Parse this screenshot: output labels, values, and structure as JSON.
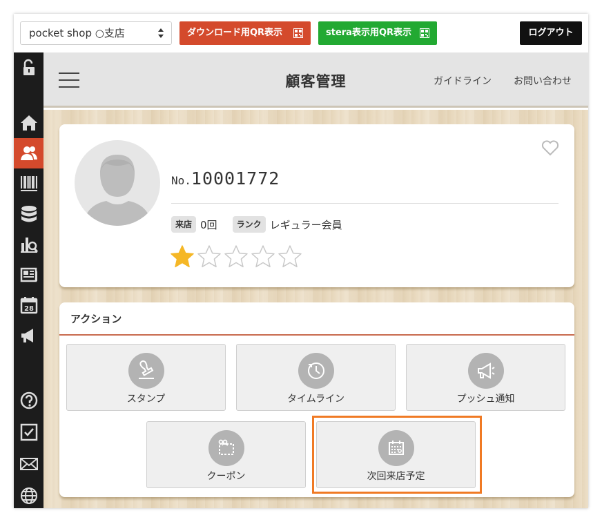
{
  "topbar": {
    "shop_select": "pocket shop ○支店",
    "download_qr": "ダウンロード用QR表示",
    "stera_qr": "stera表示用QR表示",
    "logout": "ログアウト"
  },
  "sidebar": {
    "items": [
      {
        "icon": "lock-icon"
      },
      {
        "icon": "home-icon"
      },
      {
        "icon": "users-icon",
        "active": true
      },
      {
        "icon": "barcode-icon"
      },
      {
        "icon": "database-icon"
      },
      {
        "icon": "analytics-icon"
      },
      {
        "icon": "news-icon"
      },
      {
        "icon": "calendar-icon",
        "text": "28"
      },
      {
        "icon": "megaphone-icon"
      },
      {
        "icon": "help-icon"
      },
      {
        "icon": "checkbox-icon"
      },
      {
        "icon": "mail-icon"
      },
      {
        "icon": "globe-icon"
      }
    ],
    "active_color": "#d44a2c"
  },
  "header": {
    "title": "顧客管理",
    "guideline": "ガイドライン",
    "contact": "お問い合わせ"
  },
  "profile": {
    "no_prefix": "No.",
    "member_number": "10001772",
    "visit_tag": "来店",
    "visit_value": "0回",
    "rank_tag": "ランク",
    "rank_value": "レギュラー会員",
    "rating": 1,
    "rating_max": 5
  },
  "actions": {
    "title": "アクション",
    "buttons": [
      {
        "label": "スタンプ",
        "icon": "stamp-icon"
      },
      {
        "label": "タイムライン",
        "icon": "clock-icon"
      },
      {
        "label": "プッシュ通知",
        "icon": "megaphone-icon"
      },
      {
        "label": "クーポン",
        "icon": "coupon-scissors-icon"
      },
      {
        "label": "次回来店予定",
        "icon": "calendar-icon",
        "highlighted": true
      }
    ]
  },
  "colors": {
    "accent_red": "#d44a2c",
    "stera_green": "#22a932",
    "highlight_orange": "#f07a24",
    "star_gold": "#f5b726"
  }
}
